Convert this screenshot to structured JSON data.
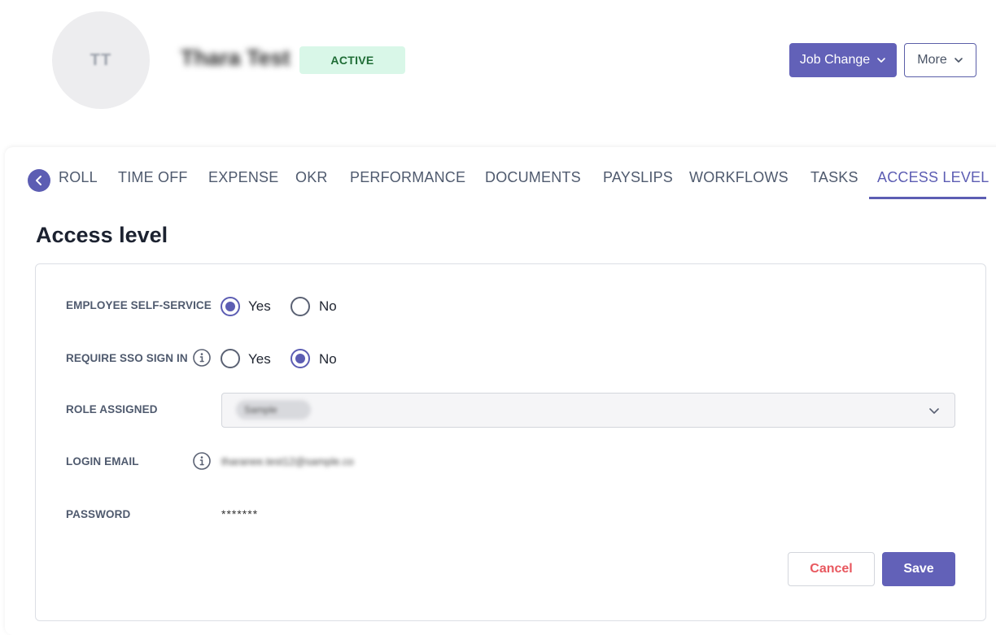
{
  "header": {
    "avatar_initials": "TT",
    "employee_name": "Thara Test",
    "status_badge": "ACTIVE",
    "job_change_label": "Job Change",
    "more_label": "More"
  },
  "tabs": {
    "items": [
      {
        "label": "ROLL"
      },
      {
        "label": "TIME OFF"
      },
      {
        "label": "EXPENSE"
      },
      {
        "label": "OKR"
      },
      {
        "label": "PERFORMANCE"
      },
      {
        "label": "DOCUMENTS"
      },
      {
        "label": "PAYSLIPS"
      },
      {
        "label": "WORKFLOWS"
      },
      {
        "label": "TASKS"
      },
      {
        "label": "ACCESS LEVEL"
      }
    ],
    "active": "ACCESS LEVEL"
  },
  "section_title": "Access level",
  "form": {
    "employee_self_service": {
      "label": "EMPLOYEE SELF-SERVICE",
      "options": [
        "Yes",
        "No"
      ],
      "selected": "Yes"
    },
    "require_sso": {
      "label": "REQUIRE SSO SIGN IN",
      "options": [
        "Yes",
        "No"
      ],
      "selected": "No"
    },
    "role_assigned": {
      "label": "ROLE ASSIGNED",
      "value": "Sample"
    },
    "login_email": {
      "label": "LOGIN EMAIL",
      "value": "tharanee.test12@sample.co"
    },
    "password": {
      "label": "PASSWORD",
      "value": "*******"
    }
  },
  "actions": {
    "cancel_label": "Cancel",
    "save_label": "Save"
  },
  "colors": {
    "accent": "#6261b8",
    "badge_bg": "#d9f7e8",
    "badge_text": "#1f6d36",
    "cancel_text": "#e8585f"
  }
}
